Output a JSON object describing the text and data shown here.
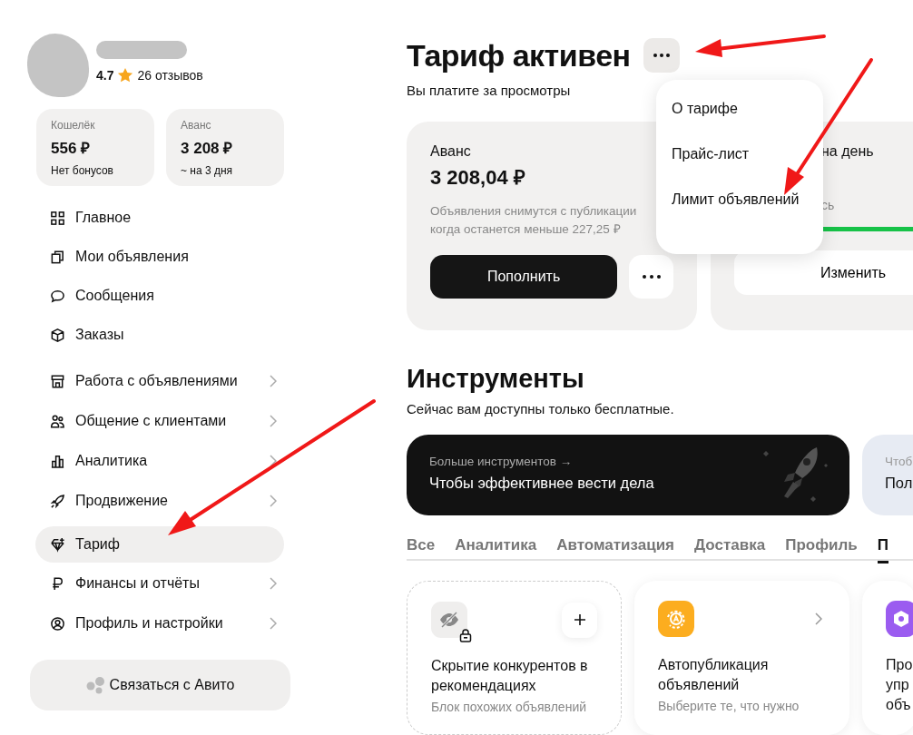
{
  "profile": {
    "rating": "4.7",
    "reviews": "26 отзывов"
  },
  "balances": [
    {
      "label": "Кошелёк",
      "amount": "556 ₽",
      "note": "Нет бонусов"
    },
    {
      "label": "Аванс",
      "amount": "3 208 ₽",
      "note": "~ на 3 дня"
    }
  ],
  "nav": [
    {
      "label": "Главное",
      "kind": "link",
      "selected": false
    },
    {
      "label": "Мои объявления",
      "kind": "link",
      "selected": false
    },
    {
      "label": "Сообщения",
      "kind": "link",
      "selected": false
    },
    {
      "label": "Заказы",
      "kind": "link",
      "selected": false
    },
    {
      "label": "Работа с объявлениями",
      "kind": "group",
      "selected": false
    },
    {
      "label": "Общение с клиентами",
      "kind": "group",
      "selected": false
    },
    {
      "label": "Аналитика",
      "kind": "group",
      "selected": false
    },
    {
      "label": "Продвижение",
      "kind": "group",
      "selected": false
    },
    {
      "label": "Тариф",
      "kind": "link",
      "selected": true
    },
    {
      "label": "Финансы и отчёты",
      "kind": "group",
      "selected": false
    },
    {
      "label": "Профиль и настройки",
      "kind": "group",
      "selected": false
    }
  ],
  "contact_button": "Связаться с Авито",
  "header": {
    "title": "Тариф активен",
    "subtitle": "Вы платите за просмотры"
  },
  "menu": {
    "items": [
      "О тарифе",
      "Прайс-лист",
      "Лимит объявлений"
    ]
  },
  "advance_card": {
    "label": "Аванс",
    "amount": "3 208,04 ₽",
    "description": "Объявления снимутся с публикации когда останется меньше 227,25 ₽",
    "button": "Пополнить"
  },
  "limit_card": {
    "label": "на день",
    "note": "сь",
    "button": "Изменить"
  },
  "tools": {
    "title": "Инструменты",
    "subtitle": "Сейчас вам доступны только бесплатные.",
    "banners": [
      {
        "kind": "dark",
        "caption": "Больше инструментов →",
        "text": "Чтобы эффективнее вести дела"
      },
      {
        "kind": "light",
        "caption": "Чтоб",
        "text": "Пол"
      }
    ],
    "tabs": [
      {
        "label": "Все",
        "selected": false
      },
      {
        "label": "Аналитика",
        "selected": false
      },
      {
        "label": "Автоматизация",
        "selected": false
      },
      {
        "label": "Доставка",
        "selected": false
      },
      {
        "label": "Профиль",
        "selected": false
      },
      {
        "label": "П",
        "selected": true
      }
    ],
    "cards": [
      {
        "kind": "locked",
        "title": "Скрытие конкурентов в рекомендациях",
        "description": "Блок похожих объявлений"
      },
      {
        "kind": "auto",
        "title": "Автопубликация объявлений",
        "description": "Выберите те, что нужно"
      },
      {
        "kind": "purple",
        "title": "Про упр объ"
      }
    ]
  }
}
